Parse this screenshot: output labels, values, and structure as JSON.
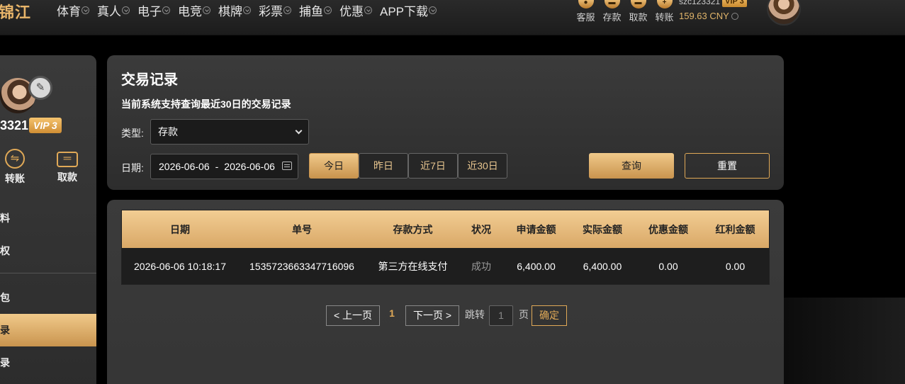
{
  "header": {
    "logo": "锦江",
    "nav": [
      {
        "label": "体育"
      },
      {
        "label": "真人"
      },
      {
        "label": "电子"
      },
      {
        "label": "电竞"
      },
      {
        "label": "棋牌"
      },
      {
        "label": "彩票"
      },
      {
        "label": "捕鱼"
      },
      {
        "label": "优惠"
      },
      {
        "label": "APP下载"
      }
    ],
    "quick": [
      {
        "label": "客服",
        "icon": "customer-service-icon"
      },
      {
        "label": "存款",
        "icon": "deposit-icon"
      },
      {
        "label": "取款",
        "icon": "withdraw-icon"
      },
      {
        "label": "转账",
        "icon": "transfer-icon"
      }
    ],
    "username": "szc123321",
    "vip": "VIP 3",
    "balance": "159.63 CNY"
  },
  "sidebar": {
    "username": "3321",
    "vip": "VIP 3",
    "actions": [
      {
        "label": "转账",
        "icon": "transfer-icon"
      },
      {
        "label": "取款",
        "icon": "card-icon"
      }
    ],
    "menu": [
      {
        "label": "料",
        "active": false
      },
      {
        "label": "权",
        "active": false
      },
      {
        "label": "包",
        "active": false
      },
      {
        "label": "录",
        "active": true
      },
      {
        "label": "录",
        "active": false
      }
    ]
  },
  "filter": {
    "title": "交易记录",
    "note": "当前系统支持查询最近30日的交易记录",
    "type_label": "类型:",
    "type_value": "存款",
    "date_label": "日期:",
    "date_start": "2026-06-06",
    "date_sep": "-",
    "date_end": "2026-06-06",
    "quick_ranges": [
      {
        "label": "今日",
        "active": true
      },
      {
        "label": "昨日",
        "active": false
      },
      {
        "label": "近7日",
        "active": false
      },
      {
        "label": "近30日",
        "active": false
      }
    ],
    "query_label": "查询",
    "reset_label": "重置"
  },
  "table": {
    "columns": [
      "日期",
      "单号",
      "存款方式",
      "状况",
      "申请金额",
      "实际金额",
      "优惠金额",
      "红利金额"
    ],
    "rows": [
      [
        "2026-06-06 10:18:17",
        "1535723663347716096",
        "第三方在线支付",
        "成功",
        "6,400.00",
        "6,400.00",
        "0.00",
        "0.00"
      ]
    ]
  },
  "pagination": {
    "prev": "< 上一页",
    "current": "1",
    "next": "下一页 >",
    "jump_label": "跳转",
    "page_input": "1",
    "page_unit": "页",
    "confirm": "确定"
  }
}
